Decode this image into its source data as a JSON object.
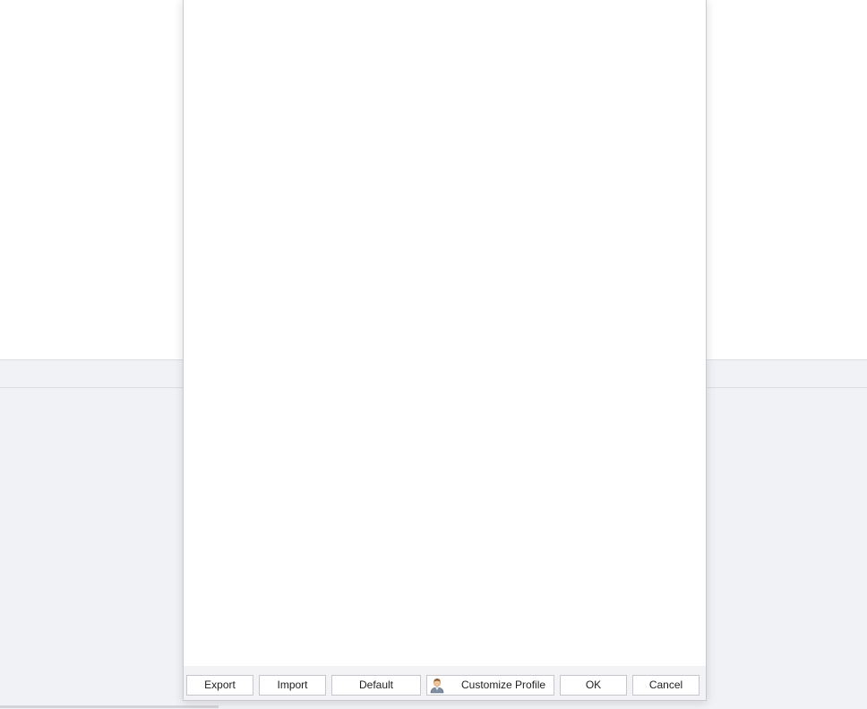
{
  "dialog": {
    "footer": {
      "export_label": "Export",
      "import_label": "Import",
      "default_label": "Default",
      "customize_profile_label": "Customize Profile",
      "ok_label": "OK",
      "cancel_label": "Cancel"
    }
  },
  "icons": {
    "customize_profile": "user-profile-icon"
  },
  "colors": {
    "app_background": "#f1f2f6",
    "dialog_background": "#ffffff",
    "footer_background": "#f3f3f5",
    "button_border": "#c6c7cc"
  }
}
